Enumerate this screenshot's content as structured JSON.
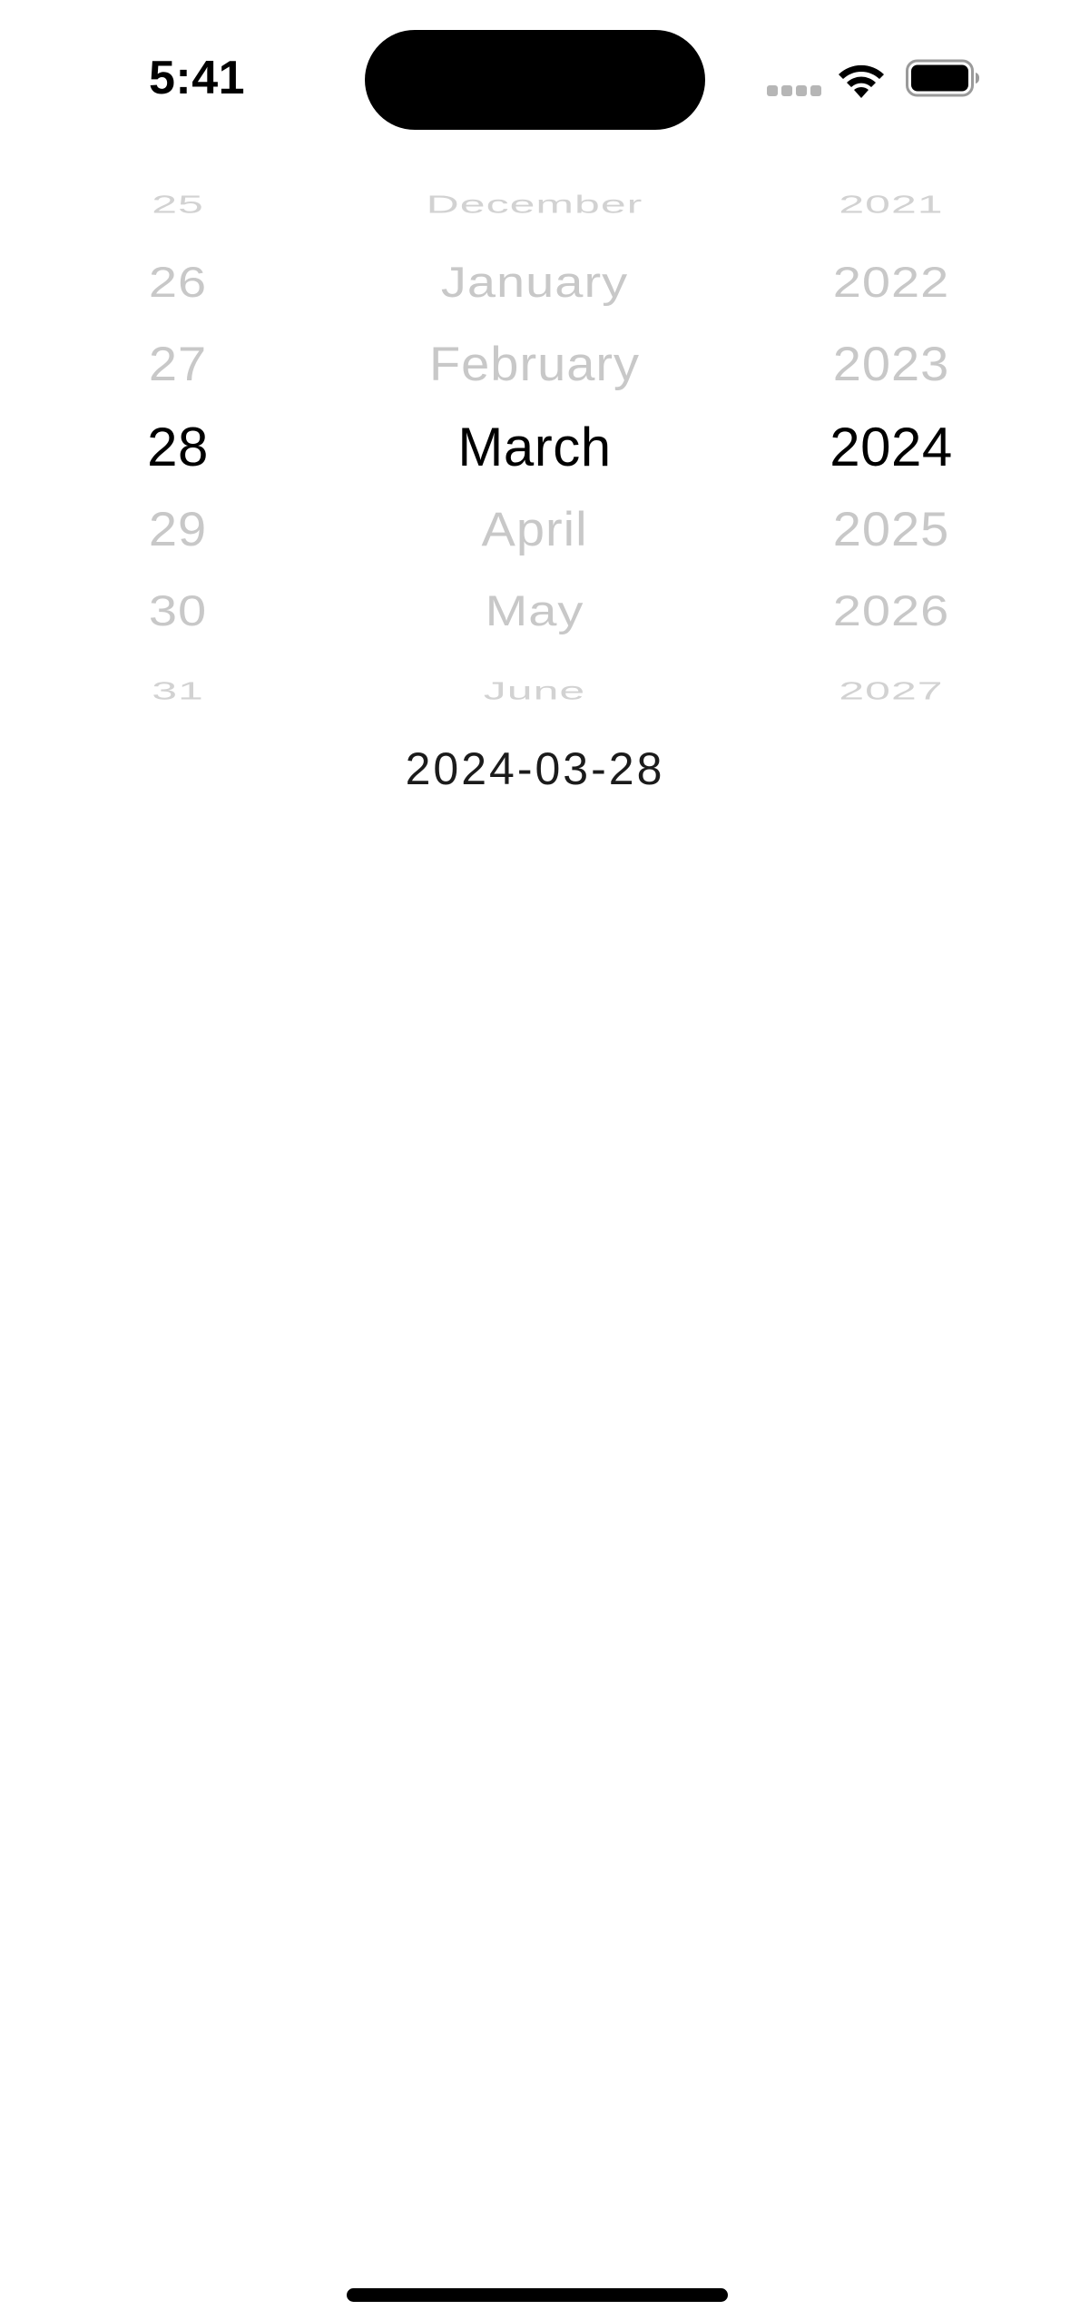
{
  "status_bar": {
    "time": "5:41",
    "icons": [
      "signal-icon",
      "wifi-icon",
      "battery-icon"
    ]
  },
  "date_picker": {
    "days": [
      "25",
      "26",
      "27",
      "28",
      "29",
      "30",
      "31"
    ],
    "months": [
      "December",
      "January",
      "February",
      "March",
      "April",
      "May",
      "June"
    ],
    "years": [
      "2021",
      "2022",
      "2023",
      "2024",
      "2025",
      "2026",
      "2027"
    ],
    "selected": {
      "day": "28",
      "month": "March",
      "year": "2024"
    }
  },
  "selected_date_text": "2024-03-28",
  "colors": {
    "selected_text": "#000000",
    "unselected_text": "#c8c8c8",
    "background": "#ffffff"
  }
}
